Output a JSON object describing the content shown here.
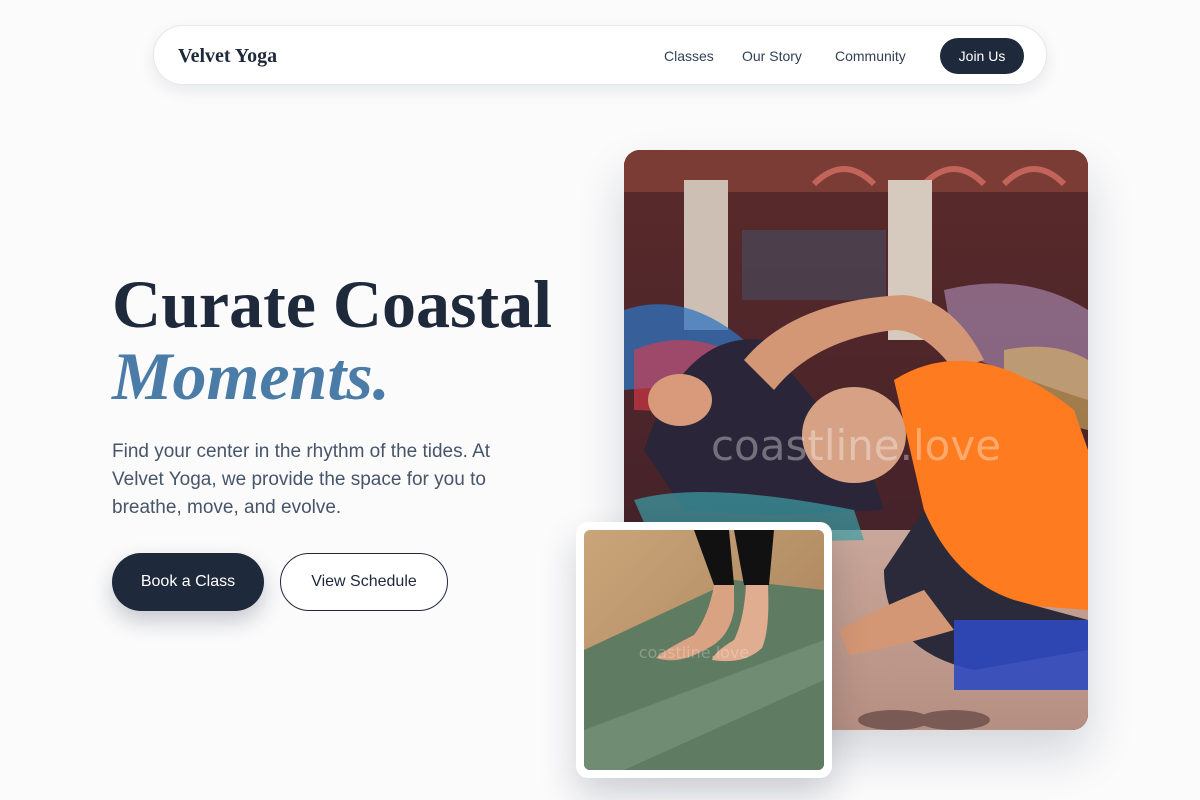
{
  "nav": {
    "brand": "Velvet Yoga",
    "links": [
      {
        "label": "Classes"
      },
      {
        "label": "Our Story"
      },
      {
        "label": "Community"
      }
    ],
    "cta": "Join Us"
  },
  "hero": {
    "headline_line1": "Curate Coastal",
    "headline_line2": "Moments.",
    "lede": "Find your center in the rhythm of the tides. At Velvet Yoga, we provide the space for you to breathe, move, and evolve.",
    "primary_button": "Book a Class",
    "secondary_button": "View Schedule"
  },
  "images": {
    "main_watermark": "coastline.love",
    "small_watermark": "coastline.love"
  },
  "colors": {
    "ink": "#1e293b",
    "accent": "#4b7ca7",
    "body_text": "#475569",
    "background": "#fbfbfc"
  }
}
